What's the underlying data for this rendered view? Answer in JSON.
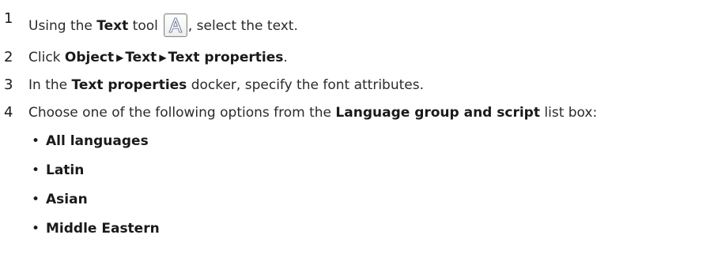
{
  "steps": [
    {
      "num": "1",
      "prefix": "Using the ",
      "bold1": "Text",
      "middle": " tool",
      "icon": "text-tool-icon",
      "suffix": ", select the text."
    },
    {
      "num": "2",
      "prefix": "Click ",
      "bold1": "Object",
      "bold2": "Text",
      "bold3": "Text properties",
      "suffix": "."
    },
    {
      "num": "3",
      "prefix": "In the ",
      "bold1": "Text properties",
      "suffix": " docker, specify the font attributes."
    },
    {
      "num": "4",
      "prefix": "Choose one of the following options from the ",
      "bold1": "Language group and script",
      "suffix": " list box:"
    }
  ],
  "options": [
    "All languages",
    "Latin",
    "Asian",
    "Middle Eastern"
  ],
  "menu_arrow": "▶",
  "bullet_char": "•"
}
